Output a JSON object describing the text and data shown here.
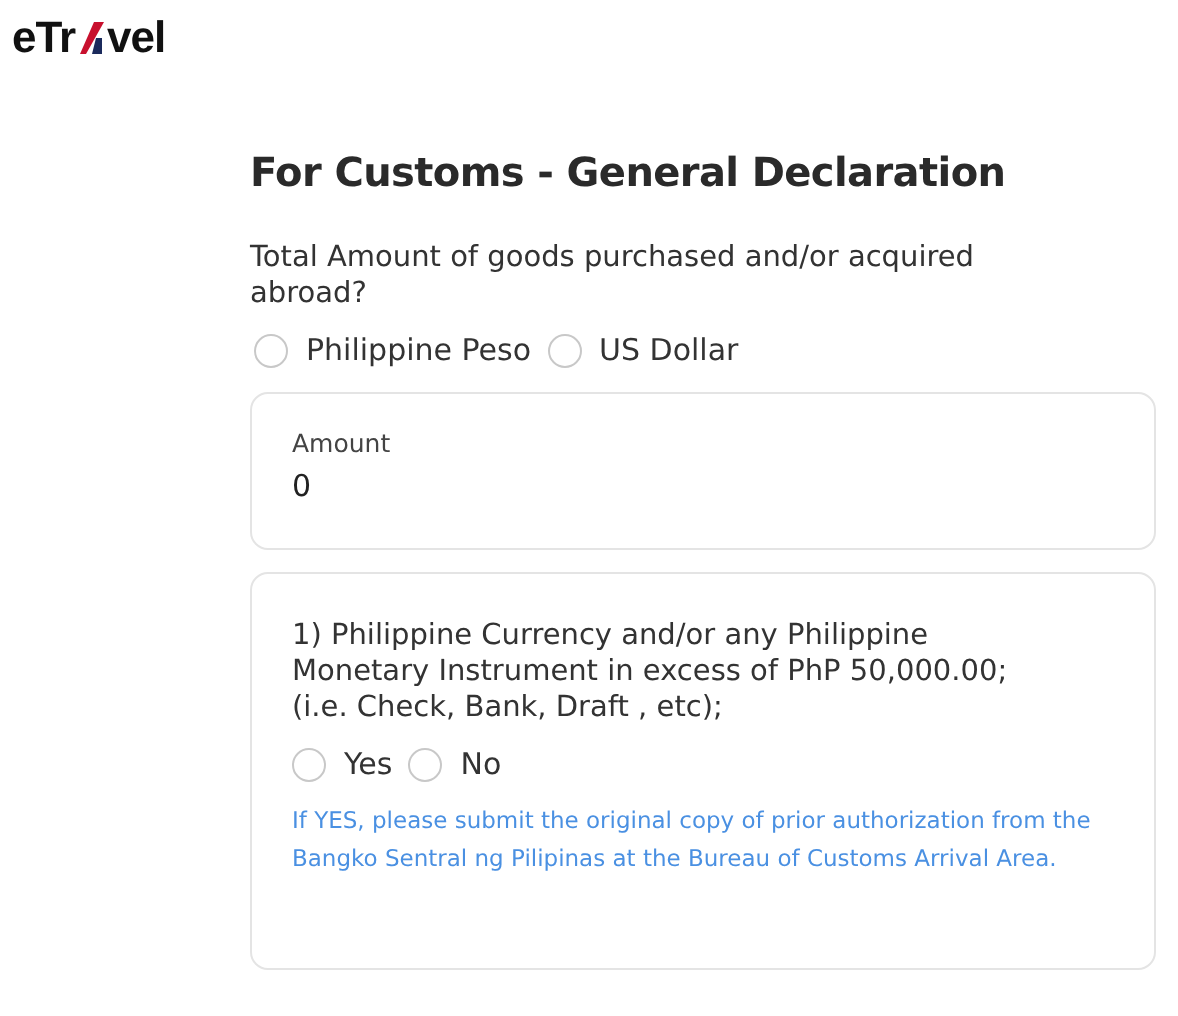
{
  "logo": {
    "before": "eTr",
    "after": "vel"
  },
  "title": "For Customs - General Declaration",
  "question": "Total Amount of goods purchased and/or acquired abroad?",
  "currency_options": [
    {
      "label": "Philippine Peso",
      "selected": false
    },
    {
      "label": "US Dollar",
      "selected": false
    }
  ],
  "amount_field": {
    "label": "Amount",
    "value": "0"
  },
  "items": [
    {
      "text": "1) Philippine Currency and/or any Philippine Monetary Instrument in excess of PhP 50,000.00; (i.e. Check, Bank, Draft , etc);",
      "options": [
        {
          "label": "Yes",
          "selected": false
        },
        {
          "label": "No",
          "selected": false
        }
      ],
      "note": "If YES, please submit the original copy of prior authorization from the Bangko Sentral ng Pilipinas at the Bureau of Customs Arrival Area."
    }
  ]
}
